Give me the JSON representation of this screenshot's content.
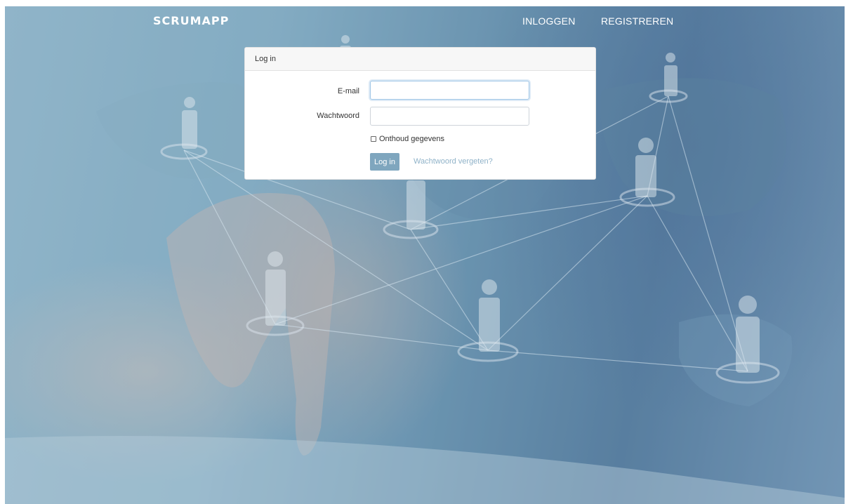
{
  "nav": {
    "brand": "SCRUMAPP",
    "login": "INLOGGEN",
    "register": "REGISTREREN"
  },
  "login_card": {
    "header": "Log in",
    "email_label": "E-mail",
    "email_value": "",
    "password_label": "Wachtwoord",
    "password_value": "",
    "remember_label": "Onthoud gegevens",
    "submit_label": "Log in",
    "forgot_label": "Wachtwoord vergeten?"
  },
  "colors": {
    "button": "#7fa6be",
    "link": "#8fb2c8",
    "background": "#6f97b3"
  }
}
